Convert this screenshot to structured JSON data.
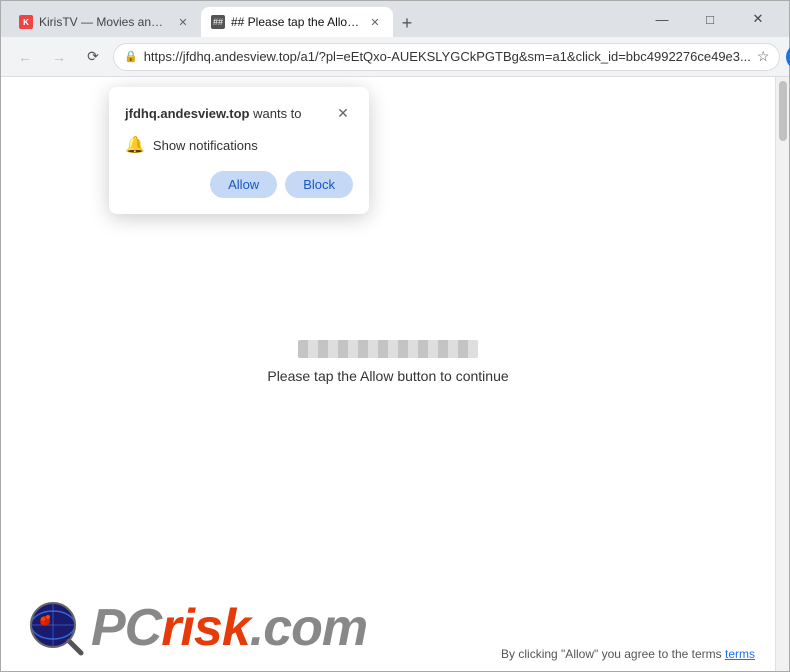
{
  "browser": {
    "tabs": [
      {
        "id": "tab1",
        "title": "KirisTV — Movies and Series D...",
        "favicon": "K",
        "active": false
      },
      {
        "id": "tab2",
        "title": "## Please tap the Allow button...",
        "favicon": "#",
        "active": true
      }
    ],
    "address": "https://jfdhq.andesview.top/a1/?pl=eEtQxo-AUEKSLYGCkPGTBg&sm=a1&click_id=bbc4992276ce49e3...",
    "window_controls": {
      "minimize": "—",
      "maximize": "□",
      "close": "✕"
    }
  },
  "popup": {
    "site": "jfdhq.andesview.top",
    "wants_to": "wants to",
    "notification_label": "Show notifications",
    "allow_label": "Allow",
    "block_label": "Block"
  },
  "page": {
    "progress_text": "Please tap the Allow button to continue"
  },
  "pcrisk": {
    "pc_text": "PC",
    "risk_text": "risk",
    "dotcom_text": ".com"
  },
  "footer": {
    "disclaimer": "By clicking \"Allow\" you agree to the terms"
  }
}
